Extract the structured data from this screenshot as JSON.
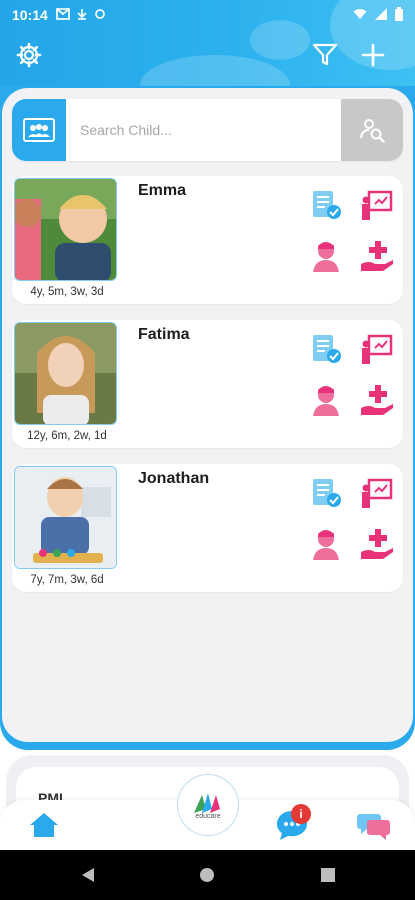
{
  "status_bar": {
    "time": "10:14",
    "icons": [
      "gmail-icon",
      "download-icon",
      "sync-icon"
    ],
    "right_icons": [
      "wifi-icon",
      "signal-icon",
      "battery-icon"
    ]
  },
  "header": {
    "left_icon": "settings-gear-icon",
    "right_icons": [
      "filter-icon",
      "add-icon"
    ]
  },
  "search": {
    "placeholder": "Search Child..."
  },
  "children": [
    {
      "name": "Emma",
      "age": "4y, 5m, 3w, 3d",
      "photo": "child-photo-emma"
    },
    {
      "name": "Fatima",
      "age": "12y, 6m, 2w, 1d",
      "photo": "child-photo-fatima"
    },
    {
      "name": "Jonathan",
      "age": "7y, 7m, 3w, 6d",
      "photo": "child-photo-jonathan"
    }
  ],
  "card_actions": [
    "report-icon",
    "presentation-icon",
    "nurse-icon",
    "medical-care-icon"
  ],
  "bottom": {
    "peek_label": "PML",
    "logo_text": "educare",
    "notification_badge": "i"
  },
  "colors": {
    "primary_blue": "#2aa9ec",
    "pink": "#e8337a",
    "light_blue": "#6fc6f2",
    "badge_red": "#e53935"
  }
}
